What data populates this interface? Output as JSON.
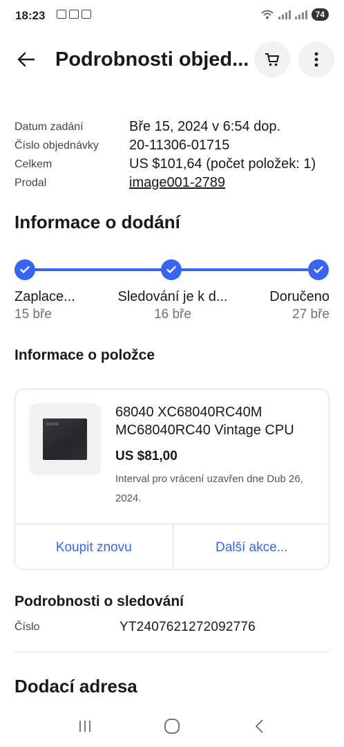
{
  "status_bar": {
    "time": "18:23",
    "battery": "74"
  },
  "app_bar": {
    "title": "Podrobnosti objed...",
    "icons": [
      "back-arrow-icon",
      "cart-icon",
      "more-vertical-icon"
    ]
  },
  "order": {
    "rows": [
      {
        "label": "Datum zadání",
        "value": "Bře 15, 2024 v 6:54 dop."
      },
      {
        "label": "Číslo objednávky",
        "value": "20-11306-01715"
      },
      {
        "label": "Celkem",
        "value": "US $101,64 (počet položek: 1)"
      },
      {
        "label": "Prodal",
        "value": "image001-2789"
      }
    ]
  },
  "delivery": {
    "title": "Informace o dodání",
    "steps": [
      {
        "label": "Zaplace...",
        "date": "15 bře"
      },
      {
        "label": "Sledování je k d...",
        "date": "16 bře"
      },
      {
        "label": "Doručeno",
        "date": "27 bře"
      }
    ],
    "accent": "#3665f3"
  },
  "item": {
    "section_title": "Informace o položce",
    "title": "68040 XC68040RC40M MC68040RC40 Vintage CPU",
    "price": "US $81,00",
    "return_note": "Interval pro vrácení uzavřen dne Dub 26, 2024.",
    "buy_again": "Koupit znovu",
    "more_actions": "Další akce..."
  },
  "tracking": {
    "title": "Podrobnosti o sledování",
    "label": "Číslo",
    "number": "YT2407621272092776"
  },
  "address": {
    "title": "Dodací adresa"
  }
}
